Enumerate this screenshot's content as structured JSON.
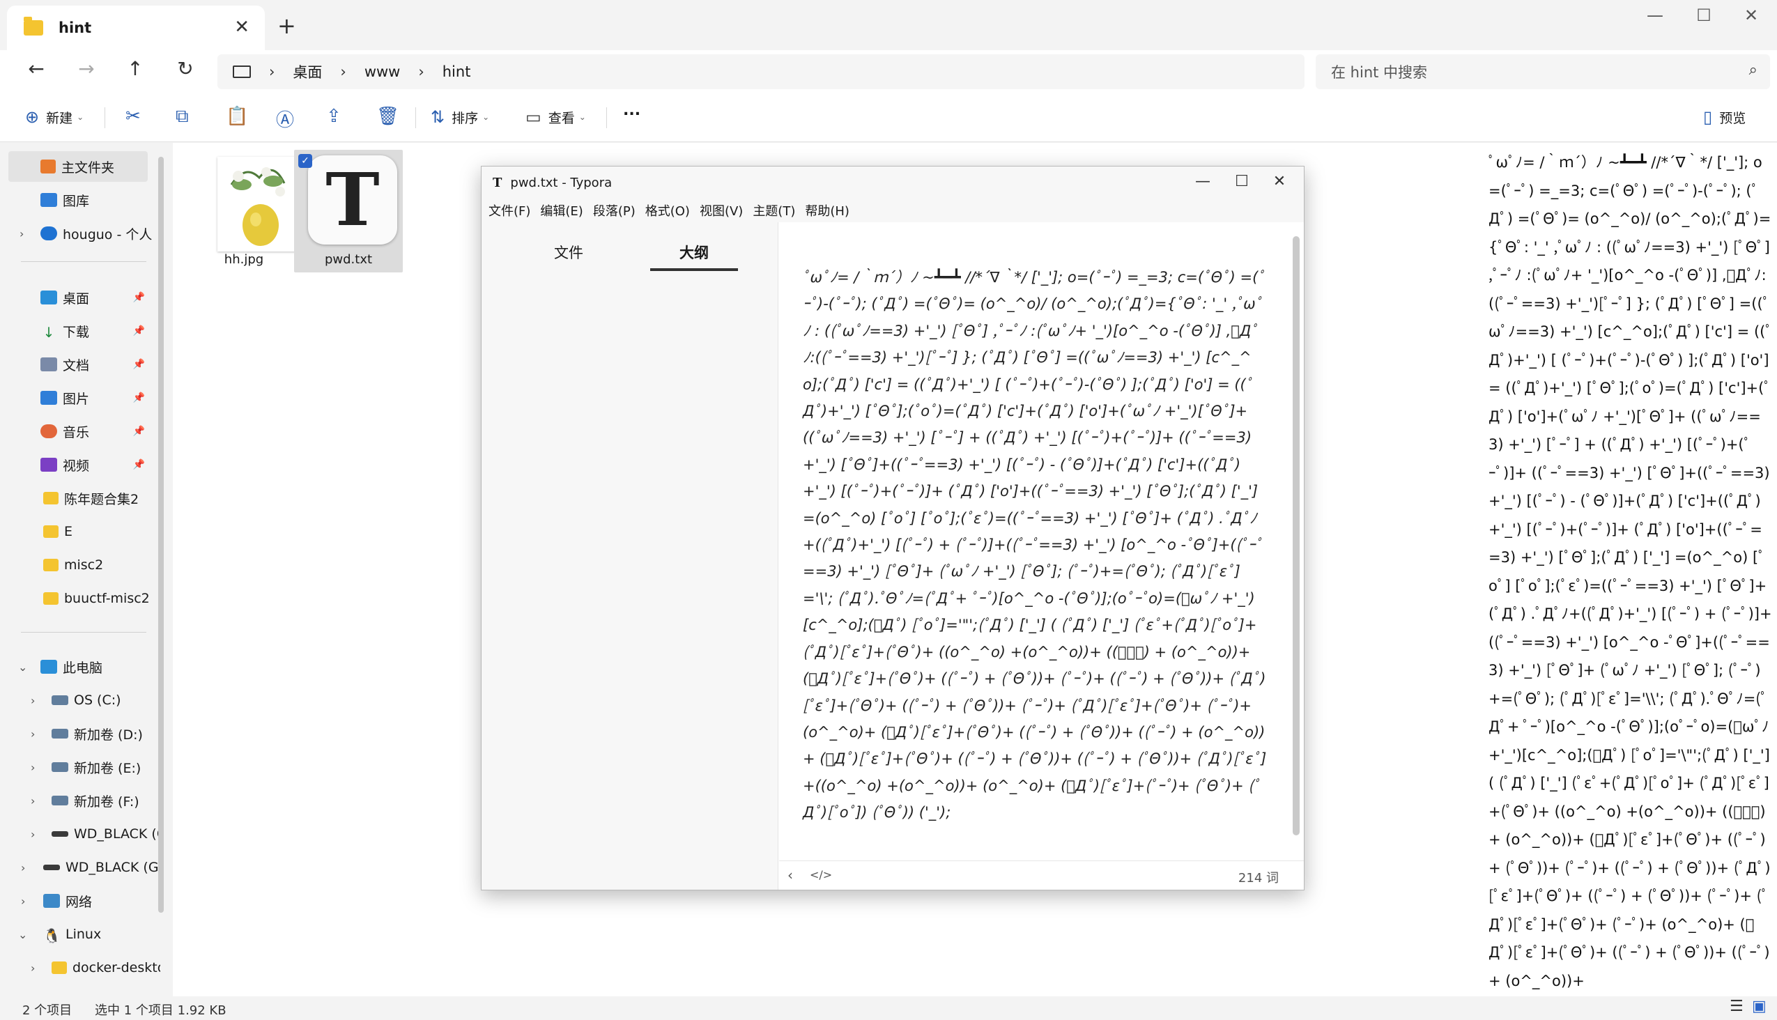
{
  "tab": {
    "title": "hint"
  },
  "address": {
    "crumbs": [
      "桌面",
      "www",
      "hint"
    ]
  },
  "search": {
    "placeholder": "在 hint 中搜索"
  },
  "toolbar": {
    "new_label": "新建",
    "sort_label": "排序",
    "view_label": "查看",
    "more": "...",
    "preview_label": "预览"
  },
  "sidebar": {
    "home": "主文件夹",
    "gallery": "图库",
    "cloud": "houguo - 个人",
    "quick": [
      "桌面",
      "下载",
      "文档",
      "图片",
      "音乐",
      "视频",
      "陈年题合集2",
      "E",
      "misc2",
      "buuctf-misc2"
    ],
    "thispc": "此电脑",
    "drives": [
      "OS (C:)",
      "新加卷 (D:)",
      "新加卷 (E:)",
      "新加卷 (F:)",
      "WD_BLACK (G:)"
    ],
    "wdblack": "WD_BLACK (G:)",
    "network": "网络",
    "linux": "Linux",
    "docker": "docker-desktop"
  },
  "files": [
    {
      "name": "hh.jpg"
    },
    {
      "name": "pwd.txt"
    }
  ],
  "typora": {
    "title": "pwd.txt - Typora",
    "menu": [
      "文件(F)",
      "编辑(E)",
      "段落(P)",
      "格式(O)",
      "视图(V)",
      "主题(T)",
      "帮助(H)"
    ],
    "tabs": [
      "文件",
      "大纲"
    ],
    "content": "ﾟωﾟﾉ= /｀ｍ´）ﾉ ~┻━┻   //*´∇｀*/ ['_']; o=(ﾟｰﾟ)  =_=3; c=(ﾟΘﾟ) =(ﾟｰﾟ)-(ﾟｰﾟ); (ﾟДﾟ) =(ﾟΘﾟ)= (o^_^o)/ (o^_^o);(ﾟДﾟ)={ﾟΘﾟ: '_' ,ﾟωﾟﾉ : ((ﾟωﾟﾉ==3) +'_') [ﾟΘﾟ] ,ﾟｰﾟﾉ :(ﾟωﾟﾉ+ '_')[o^_^o -(ﾟΘﾟ)] ,ﾟДﾟﾉ:((ﾟｰﾟ==3) +'_')[ﾟｰﾟ] }; (ﾟДﾟ) [ﾟΘﾟ] =((ﾟωﾟﾉ==3) +'_') [c^_^o];(ﾟДﾟ) ['c'] = ((ﾟДﾟ)+'_') [ (ﾟｰﾟ)+(ﾟｰﾟ)-(ﾟΘﾟ) ];(ﾟДﾟ) ['o'] = ((ﾟДﾟ)+'_') [ﾟΘﾟ];(ﾟoﾟ)=(ﾟДﾟ) ['c']+(ﾟДﾟ) ['o']+(ﾟωﾟﾉ +'_')[ﾟΘﾟ]+ ((ﾟωﾟﾉ==3) +'_') [ﾟｰﾟ] + ((ﾟДﾟ) +'_') [(ﾟｰﾟ)+(ﾟｰﾟ)]+ ((ﾟｰﾟ==3) +'_') [ﾟΘﾟ]+((ﾟｰﾟ==3) +'_') [(ﾟｰﾟ) - (ﾟΘﾟ)]+(ﾟДﾟ) ['c']+((ﾟДﾟ)+'_') [(ﾟｰﾟ)+(ﾟｰﾟ)]+ (ﾟДﾟ) ['o']+((ﾟｰﾟ==3) +'_') [ﾟΘﾟ];(ﾟДﾟ) ['_'] =(o^_^o) [ﾟoﾟ] [ﾟoﾟ];(ﾟεﾟ)=((ﾟｰﾟ==3) +'_') [ﾟΘﾟ]+ (ﾟДﾟ) .ﾟДﾟﾉ+((ﾟДﾟ)+'_') [(ﾟｰﾟ) + (ﾟｰﾟ)]+((ﾟｰﾟ==3) +'_') [o^_^o -ﾟΘﾟ]+((ﾟｰﾟ==3) +'_') [ﾟΘﾟ]+ (ﾟωﾟﾉ +'_') [ﾟΘﾟ]; (ﾟｰﾟ)+=(ﾟΘﾟ); (ﾟДﾟ)[ﾟεﾟ]='\\'; (ﾟДﾟ).ﾟΘﾟﾉ=(ﾟДﾟ+ ﾟｰﾟ)[o^_^o -(ﾟΘﾟ)];(oﾟｰﾟo)=(ﾟωﾟﾉ +'_')[c^_^o];(ﾟДﾟ) [ﾟoﾟ]='\"';(ﾟДﾟ) ['_'] ( (ﾟДﾟ) ['_'] (ﾟεﾟ+(ﾟДﾟ)[ﾟoﾟ]+ (ﾟДﾟ)[ﾟεﾟ]+(ﾟΘﾟ)+ ((o^_^o) +(o^_^o))+ ((ﾟｰﾟ) + (o^_^o))+ (ﾟДﾟ)[ﾟεﾟ]+(ﾟΘﾟ)+ ((ﾟｰﾟ) + (ﾟΘﾟ))+ (ﾟｰﾟ)+ ((ﾟｰﾟ) + (ﾟΘﾟ))+ (ﾟДﾟ)[ﾟεﾟ]+(ﾟΘﾟ)+ ((ﾟｰﾟ) + (ﾟΘﾟ))+ (ﾟｰﾟ)+ (ﾟДﾟ)[ﾟεﾟ]+(ﾟΘﾟ)+ (ﾟｰﾟ)+ (o^_^o)+ (ﾟДﾟ)[ﾟεﾟ]+(ﾟΘﾟ)+ ((ﾟｰﾟ) + (ﾟΘﾟ))+ ((ﾟｰﾟ) + (o^_^o))+ (ﾟДﾟ)[ﾟεﾟ]+(ﾟΘﾟ)+ ((ﾟｰﾟ) + (ﾟΘﾟ))+ ((ﾟｰﾟ) + (ﾟΘﾟ))+ (ﾟДﾟ)[ﾟεﾟ]+((o^_^o) +(o^_^o))+ (o^_^o)+ (ﾟДﾟ)[ﾟεﾟ]+(ﾟｰﾟ)+ (ﾟΘﾟ)+ (ﾟДﾟ)[ﾟoﾟ]) (ﾟΘﾟ)) ('_');",
    "word_count": "214 词"
  },
  "side_text": "ﾟωﾟﾉ= /｀ｍ´）ﾉ ~┻━┻ //*´∇｀*/ ['_']; o=(ﾟｰﾟ) =_=3; c=(ﾟΘﾟ) =(ﾟｰﾟ)-(ﾟｰﾟ); (ﾟДﾟ) =(ﾟΘﾟ)= (o^_^o)/ (o^_^o);(ﾟДﾟ)={ﾟΘﾟ: '_' ,ﾟωﾟﾉ : ((ﾟωﾟﾉ==3) +'_') [ﾟΘﾟ] ,ﾟｰﾟﾉ :(ﾟωﾟﾉ+ '_')[o^_^o -(ﾟΘﾟ)] ,ﾟДﾟﾉ:((ﾟｰﾟ==3) +'_')[ﾟｰﾟ] }; (ﾟДﾟ) [ﾟΘﾟ] =((ﾟωﾟﾉ==3) +'_') [c^_^o];(ﾟДﾟ) ['c'] = ((ﾟДﾟ)+'_') [ (ﾟｰﾟ)+(ﾟｰﾟ)-(ﾟΘﾟ) ];(ﾟДﾟ) ['o'] = ((ﾟДﾟ)+'_') [ﾟΘﾟ];(ﾟoﾟ)=(ﾟДﾟ) ['c']+(ﾟДﾟ) ['o']+(ﾟωﾟﾉ +'_')[ﾟΘﾟ]+ ((ﾟωﾟﾉ==3) +'_') [ﾟｰﾟ] + ((ﾟДﾟ) +'_') [(ﾟｰﾟ)+(ﾟｰﾟ)]+ ((ﾟｰﾟ==3) +'_') [ﾟΘﾟ]+((ﾟｰﾟ==3) +'_') [(ﾟｰﾟ) - (ﾟΘﾟ)]+(ﾟДﾟ) ['c']+((ﾟДﾟ)+'_') [(ﾟｰﾟ)+(ﾟｰﾟ)]+ (ﾟДﾟ) ['o']+((ﾟｰﾟ==3) +'_') [ﾟΘﾟ];(ﾟДﾟ) ['_'] =(o^_^o) [ﾟoﾟ] [ﾟoﾟ];(ﾟεﾟ)=((ﾟｰﾟ==3) +'_') [ﾟΘﾟ]+ (ﾟДﾟ) .ﾟДﾟﾉ+((ﾟДﾟ)+'_') [(ﾟｰﾟ) + (ﾟｰﾟ)]+((ﾟｰﾟ==3) +'_') [o^_^o -ﾟΘﾟ]+((ﾟｰﾟ==3) +'_') [ﾟΘﾟ]+ (ﾟωﾟﾉ +'_') [ﾟΘﾟ]; (ﾟｰﾟ)+=(ﾟΘﾟ); (ﾟДﾟ)[ﾟεﾟ]='\\\\'; (ﾟДﾟ).ﾟΘﾟﾉ=(ﾟДﾟ+ ﾟｰﾟ)[o^_^o -(ﾟΘﾟ)];(oﾟｰﾟo)=(ﾟωﾟﾉ +'_')[c^_^o];(ﾟДﾟ) [ﾟoﾟ]='\\\"';(ﾟДﾟ) ['_'] ( (ﾟДﾟ) ['_'] (ﾟεﾟ+(ﾟДﾟ)[ﾟoﾟ]+ (ﾟДﾟ)[ﾟεﾟ]+(ﾟΘﾟ)+ ((o^_^o) +(o^_^o))+ ((ﾟｰﾟ) + (o^_^o))+ (ﾟДﾟ)[ﾟεﾟ]+(ﾟΘﾟ)+ ((ﾟｰﾟ) + (ﾟΘﾟ))+ (ﾟｰﾟ)+ ((ﾟｰﾟ) + (ﾟΘﾟ))+ (ﾟДﾟ)[ﾟεﾟ]+(ﾟΘﾟ)+ ((ﾟｰﾟ) + (ﾟΘﾟ))+ (ﾟｰﾟ)+ (ﾟДﾟ)[ﾟεﾟ]+(ﾟΘﾟ)+ (ﾟｰﾟ)+ (o^_^o)+ (ﾟДﾟ)[ﾟεﾟ]+(ﾟΘﾟ)+ ((ﾟｰﾟ) + (ﾟΘﾟ))+ ((ﾟｰﾟ) + (o^_^o))+",
  "status": {
    "count": "2 个项目",
    "selected": "选中 1 个项目  1.92 KB"
  },
  "colors": {
    "accent": "#2b64c8",
    "folder": "#f4c430",
    "window_bg": "#f3f3f3"
  }
}
